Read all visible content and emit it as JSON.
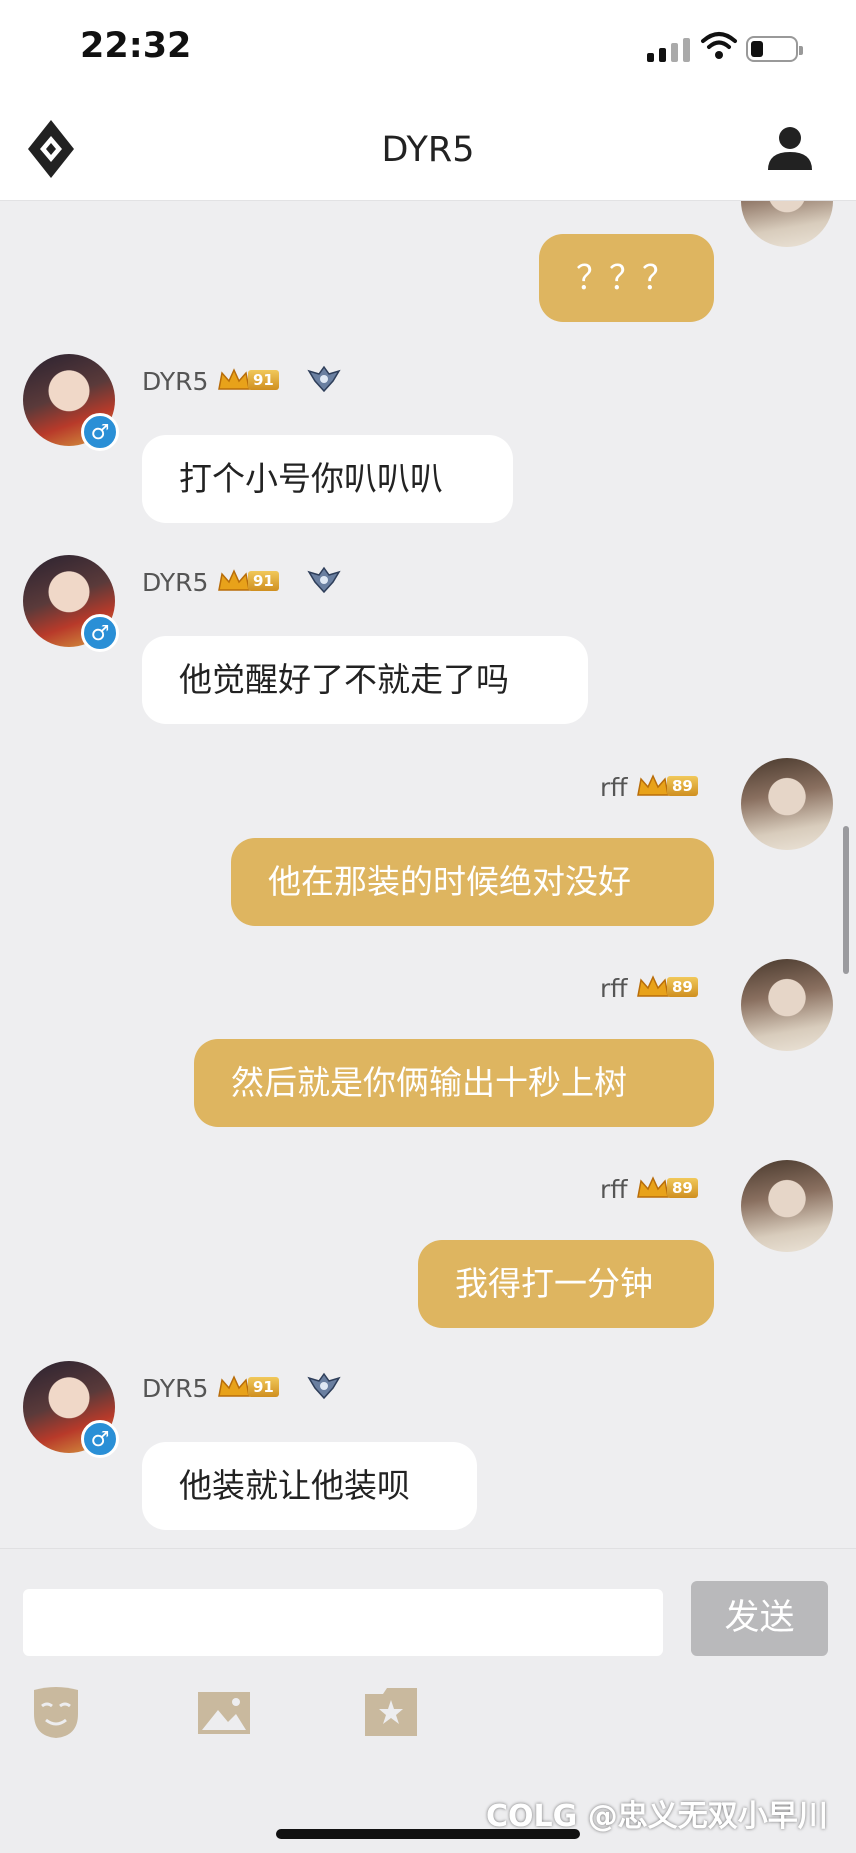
{
  "status_bar": {
    "time": "22:32"
  },
  "header": {
    "title": "DYR5"
  },
  "messages": [
    {
      "side": "right",
      "sender": "",
      "level": "",
      "text": "？？？"
    },
    {
      "side": "left",
      "sender": "DYR5",
      "level": "91",
      "text": "打个小号你叭叭叭"
    },
    {
      "side": "left",
      "sender": "DYR5",
      "level": "91",
      "text": "他觉醒好了不就走了吗"
    },
    {
      "side": "right",
      "sender": "rff",
      "level": "89",
      "text": "他在那装的时候绝对没好"
    },
    {
      "side": "right",
      "sender": "rff",
      "level": "89",
      "text": "然后就是你俩输出十秒上树"
    },
    {
      "side": "right",
      "sender": "rff",
      "level": "89",
      "text": "我得打一分钟"
    },
    {
      "side": "left",
      "sender": "DYR5",
      "level": "91",
      "text": "他装就让他装呗"
    }
  ],
  "gender_symbol": "♂",
  "composer": {
    "placeholder": "",
    "send_label": "发送"
  },
  "toolbar": {
    "icons": [
      "emoji-mask-icon",
      "image-icon",
      "sticker-icon"
    ]
  },
  "watermark": "COLG @忠义无双小早川",
  "colors": {
    "self_bubble": "#deb560",
    "other_bubble": "#ffffff",
    "send_disabled": "#b9b9bb",
    "gender_badge": "#2a8fd6"
  }
}
